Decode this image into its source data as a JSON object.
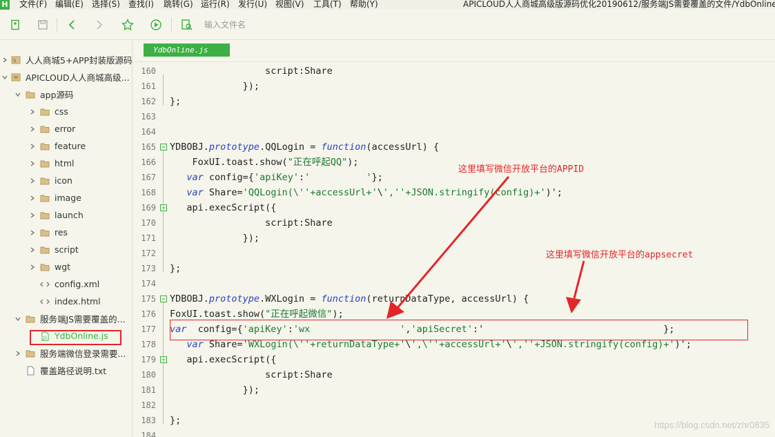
{
  "menubar": {
    "logo": "H",
    "items": [
      "文件(F)",
      "编辑(E)",
      "选择(S)",
      "查找(I)",
      "跳转(G)",
      "运行(R)",
      "发行(U)",
      "视图(V)",
      "工具(T)",
      "帮助(Y)"
    ],
    "title": "APICLOUD人人商城高级版源码优化20190612/服务端JS需要覆盖的文件/YdbOnline"
  },
  "toolbar": {
    "icons": [
      "new-file-icon",
      "save-icon",
      "back-icon",
      "forward-icon",
      "favorite-icon",
      "run-icon",
      "preview-icon"
    ],
    "search_placeholder": "输入文件名"
  },
  "sidebar": {
    "items": [
      {
        "label": "人人商城5+APP封装版源码"
      },
      {
        "label": "APICLOUD人人商城高级..."
      },
      {
        "label": "app源码"
      },
      {
        "label": "css"
      },
      {
        "label": "error"
      },
      {
        "label": "feature"
      },
      {
        "label": "html"
      },
      {
        "label": "icon"
      },
      {
        "label": "image"
      },
      {
        "label": "launch"
      },
      {
        "label": "res"
      },
      {
        "label": "script"
      },
      {
        "label": "wgt"
      },
      {
        "label": "config.xml"
      },
      {
        "label": "index.html"
      },
      {
        "label": "服务端JS需要覆盖的..."
      },
      {
        "label": "YdbOnline.js"
      },
      {
        "label": "服务端微信登录需要..."
      },
      {
        "label": "覆盖路径说明.txt"
      }
    ]
  },
  "editor": {
    "tab_label": "YdbOnline.js",
    "lines": [
      {
        "n": "160",
        "text": "                 script:Share"
      },
      {
        "n": "161",
        "text": "             });"
      },
      {
        "n": "162",
        "text": "};"
      },
      {
        "n": "163",
        "text": ""
      },
      {
        "n": "164",
        "text": ""
      },
      {
        "n": "165",
        "text": "YDBOBJ.prototype.QQLogin = function(accessUrl) {"
      },
      {
        "n": "166",
        "text": "    FoxUI.toast.show(\"正在呼起QQ\");"
      },
      {
        "n": "167",
        "text": "   var config={'apiKey':'          '};"
      },
      {
        "n": "168",
        "text": "   var Share='QQLogin(\\''+accessUrl+'\\',''+JSON.stringify(config)+')';"
      },
      {
        "n": "169",
        "text": "   api.execScript({"
      },
      {
        "n": "170",
        "text": "                 script:Share"
      },
      {
        "n": "171",
        "text": "             });"
      },
      {
        "n": "172",
        "text": ""
      },
      {
        "n": "173",
        "text": "};"
      },
      {
        "n": "174",
        "text": ""
      },
      {
        "n": "175",
        "text": "YDBOBJ.prototype.WXLogin = function(returnDataType, accessUrl) {"
      },
      {
        "n": "176",
        "text": "FoxUI.toast.show(\"正在呼起微信\");"
      },
      {
        "n": "177",
        "text": "var  config={'apiKey':'wx                ','apiSecret':'                                };"
      },
      {
        "n": "178",
        "text": "   var Share='WXLogin(\\''+returnDataType+'\\',\\''+accessUrl+'\\',''+JSON.stringify(config)+')';"
      },
      {
        "n": "179",
        "text": "   api.execScript({"
      },
      {
        "n": "180",
        "text": "                 script:Share"
      },
      {
        "n": "181",
        "text": "             });"
      },
      {
        "n": "182",
        "text": ""
      },
      {
        "n": "183",
        "text": "};"
      },
      {
        "n": "184",
        "text": ""
      }
    ]
  },
  "annotations": {
    "appid_note": "这里填写微信开放平台的APPID",
    "secret_note": "这里填写微信开放平台的appsecret",
    "color": "#e2262a"
  },
  "watermark": "https://blog.csdn.net/zhr0835",
  "colors": {
    "accent": "#3cb044",
    "keyword": "#2b41c4",
    "string": "#1a7a32",
    "background": "#f5f5eb"
  }
}
